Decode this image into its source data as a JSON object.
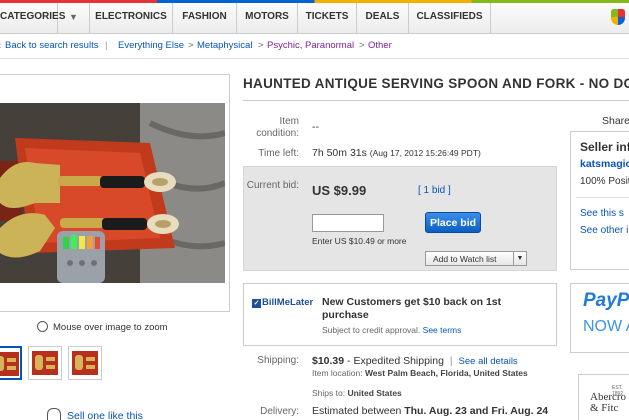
{
  "topnav": {
    "categories": "CATEGORIES",
    "dropdown": "▼",
    "tabs": [
      "ELECTRONICS",
      "FASHION",
      "MOTORS",
      "TICKETS",
      "DEALS",
      "CLASSIFIEDS"
    ]
  },
  "breadcrumb": {
    "back": "Back to search results",
    "sep": "|",
    "items": [
      "Everything Else",
      "Metaphysical",
      "Psychic, Paranormal",
      "Other"
    ],
    "arrow": ">"
  },
  "photo": {
    "zoom_hint": "Mouse over image to zoom",
    "sell_link": "Sell one like this"
  },
  "listing": {
    "title": "HAUNTED ANTIQUE SERVING SPOON AND FORK - NO DOLL",
    "condition_label": "Item condition:",
    "condition_value": "--",
    "time_label": "Time left:",
    "time_value": "7h 50m 31s",
    "time_end": "(Aug 17, 2012 15:26:49 PDT)",
    "bid_label": "Current bid:",
    "price": "US $9.99",
    "bid_count": "[ 1 bid ]",
    "bid_input": "",
    "place_bid": "Place bid",
    "enter_hint": "Enter US $10.49 or more",
    "watch_label": "Add to Watch list",
    "watch_arrow": "▼"
  },
  "billmelater": {
    "logo": "BillMeLater",
    "logo_mark": "✓",
    "headline": "New Customers get $10 back on 1st purchase",
    "sub": "Subject to credit approval.",
    "terms_link": "See terms"
  },
  "shipping": {
    "label": "Shipping:",
    "cost": "$10.39",
    "method": "- Expedited Shipping",
    "sep": "|",
    "details_link": "See all details",
    "location_label": "Item location:",
    "location": "West Palm Beach, Florida, United States",
    "ships_label": "Ships to:",
    "ships_to": "United States"
  },
  "delivery": {
    "label": "Delivery:",
    "text": "Estimated between",
    "range": "Thu. Aug. 23 and Fri. Aug. 24"
  },
  "right": {
    "share": "Share",
    "seller_title": "Seller info",
    "seller_name": "katsmagic",
    "seller_positive": "100% Positive",
    "see_link": "See this s",
    "other_link": "See other i"
  },
  "ads": {
    "paypal": "PayPal",
    "paypal_now": "NOW A",
    "ad2_small": "EST. 1892",
    "ad2_line1": "Abercro",
    "ad2_line2": "& Fitc"
  }
}
